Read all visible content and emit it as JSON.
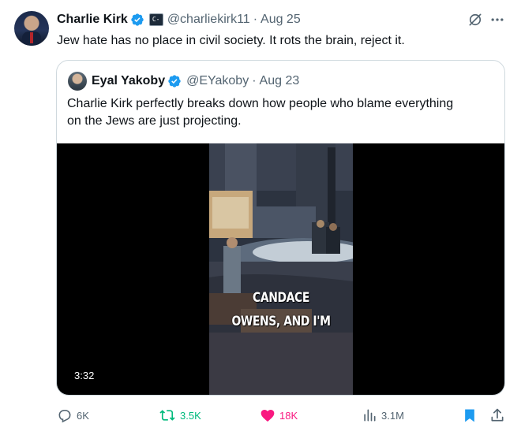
{
  "tweet": {
    "author_name": "Charlie Kirk",
    "handle": "@charliekirk11",
    "separator": "·",
    "date": "Aug 25",
    "text": "Jew hate has no place in civil society. It rots the brain, reject it.",
    "verified_color": "#1d9bf0",
    "icons": [
      "verified-badge-icon",
      "affiliate-badge-icon",
      "grok-icon",
      "more-icon"
    ]
  },
  "quoted": {
    "author_name": "Eyal Yakoby",
    "handle": "@EYakoby",
    "separator": "·",
    "date": "Aug 23",
    "text_lines": [
      "Charlie Kirk perfectly breaks down how people who blame everything",
      "on the Jews are just projecting."
    ],
    "video": {
      "caption_lines": [
        "CANDACE",
        "OWENS, AND I'M"
      ],
      "duration": "3:32"
    }
  },
  "actions": {
    "replies": "6K",
    "reposts": "3.5K",
    "likes": "18K",
    "views": "3.1M",
    "repost_color": "#00ba7c",
    "like_color": "#f91880",
    "bookmark_color": "#1d9bf0",
    "icons": [
      "reply-icon",
      "repost-icon",
      "like-icon",
      "views-icon",
      "bookmark-icon",
      "share-icon"
    ]
  }
}
